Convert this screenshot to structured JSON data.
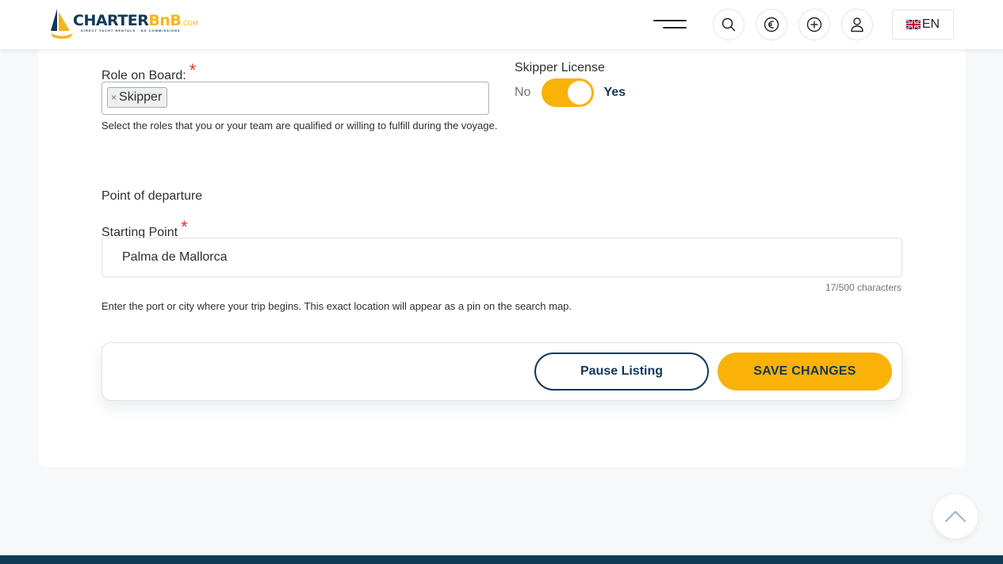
{
  "brand": {
    "name_part1": "CHARTER",
    "name_part2": "BnB",
    "name_suffix": ".COM",
    "tagline": "DIRECT YACHT RENTALS · NO COMMISSIONS"
  },
  "header": {
    "language": "EN"
  },
  "colors": {
    "accent": "#f9b208",
    "navy": "#10395a",
    "required": "#e3342f"
  },
  "form": {
    "role": {
      "label": "Role on Board:",
      "required_mark": "*",
      "selected": [
        "Skipper"
      ],
      "remove_glyph": "×",
      "help": "Select the roles that you or your team are qualified or willing to fulfill during the voyage."
    },
    "skipper_license": {
      "label": "Skipper License",
      "off_label": "No",
      "on_label": "Yes",
      "value": true
    },
    "departure": {
      "section_title": "Point of departure",
      "label": "Starting Point",
      "required_mark": "*",
      "value": "Palma de Mallorca",
      "counter": "17/500 characters",
      "help": "Enter the port or city where your trip begins. This exact location will appear as a pin on the search map."
    }
  },
  "actions": {
    "pause_label": "Pause Listing",
    "save_label": "SAVE CHANGES"
  }
}
